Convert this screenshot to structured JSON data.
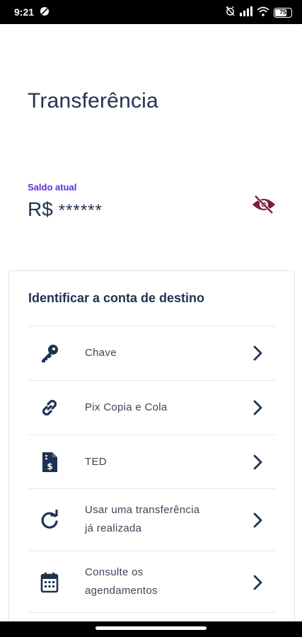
{
  "status": {
    "time": "9:21",
    "battery": "75",
    "battery_level": 0.75
  },
  "header": {
    "title": "Transferência"
  },
  "balance": {
    "label": "Saldo atual",
    "currency": "R$",
    "masked_value": "******",
    "eye_icon": "eye-off-icon",
    "accent_color": "#5b2fd1",
    "eye_color": "#7a1f3d"
  },
  "destination": {
    "title": "Identificar a conta de destino",
    "options": [
      {
        "label": "Chave",
        "icon": "key-icon"
      },
      {
        "label": "Pix Copia e Cola",
        "icon": "link-icon"
      },
      {
        "label": "TED",
        "icon": "ted-document-icon"
      },
      {
        "label_line1": "Usar uma transferência",
        "label_line2": "já realizada",
        "icon": "refresh-icon"
      },
      {
        "label_line1": "Consulte os",
        "label_line2": "agendamentos",
        "icon": "calendar-icon"
      }
    ]
  }
}
